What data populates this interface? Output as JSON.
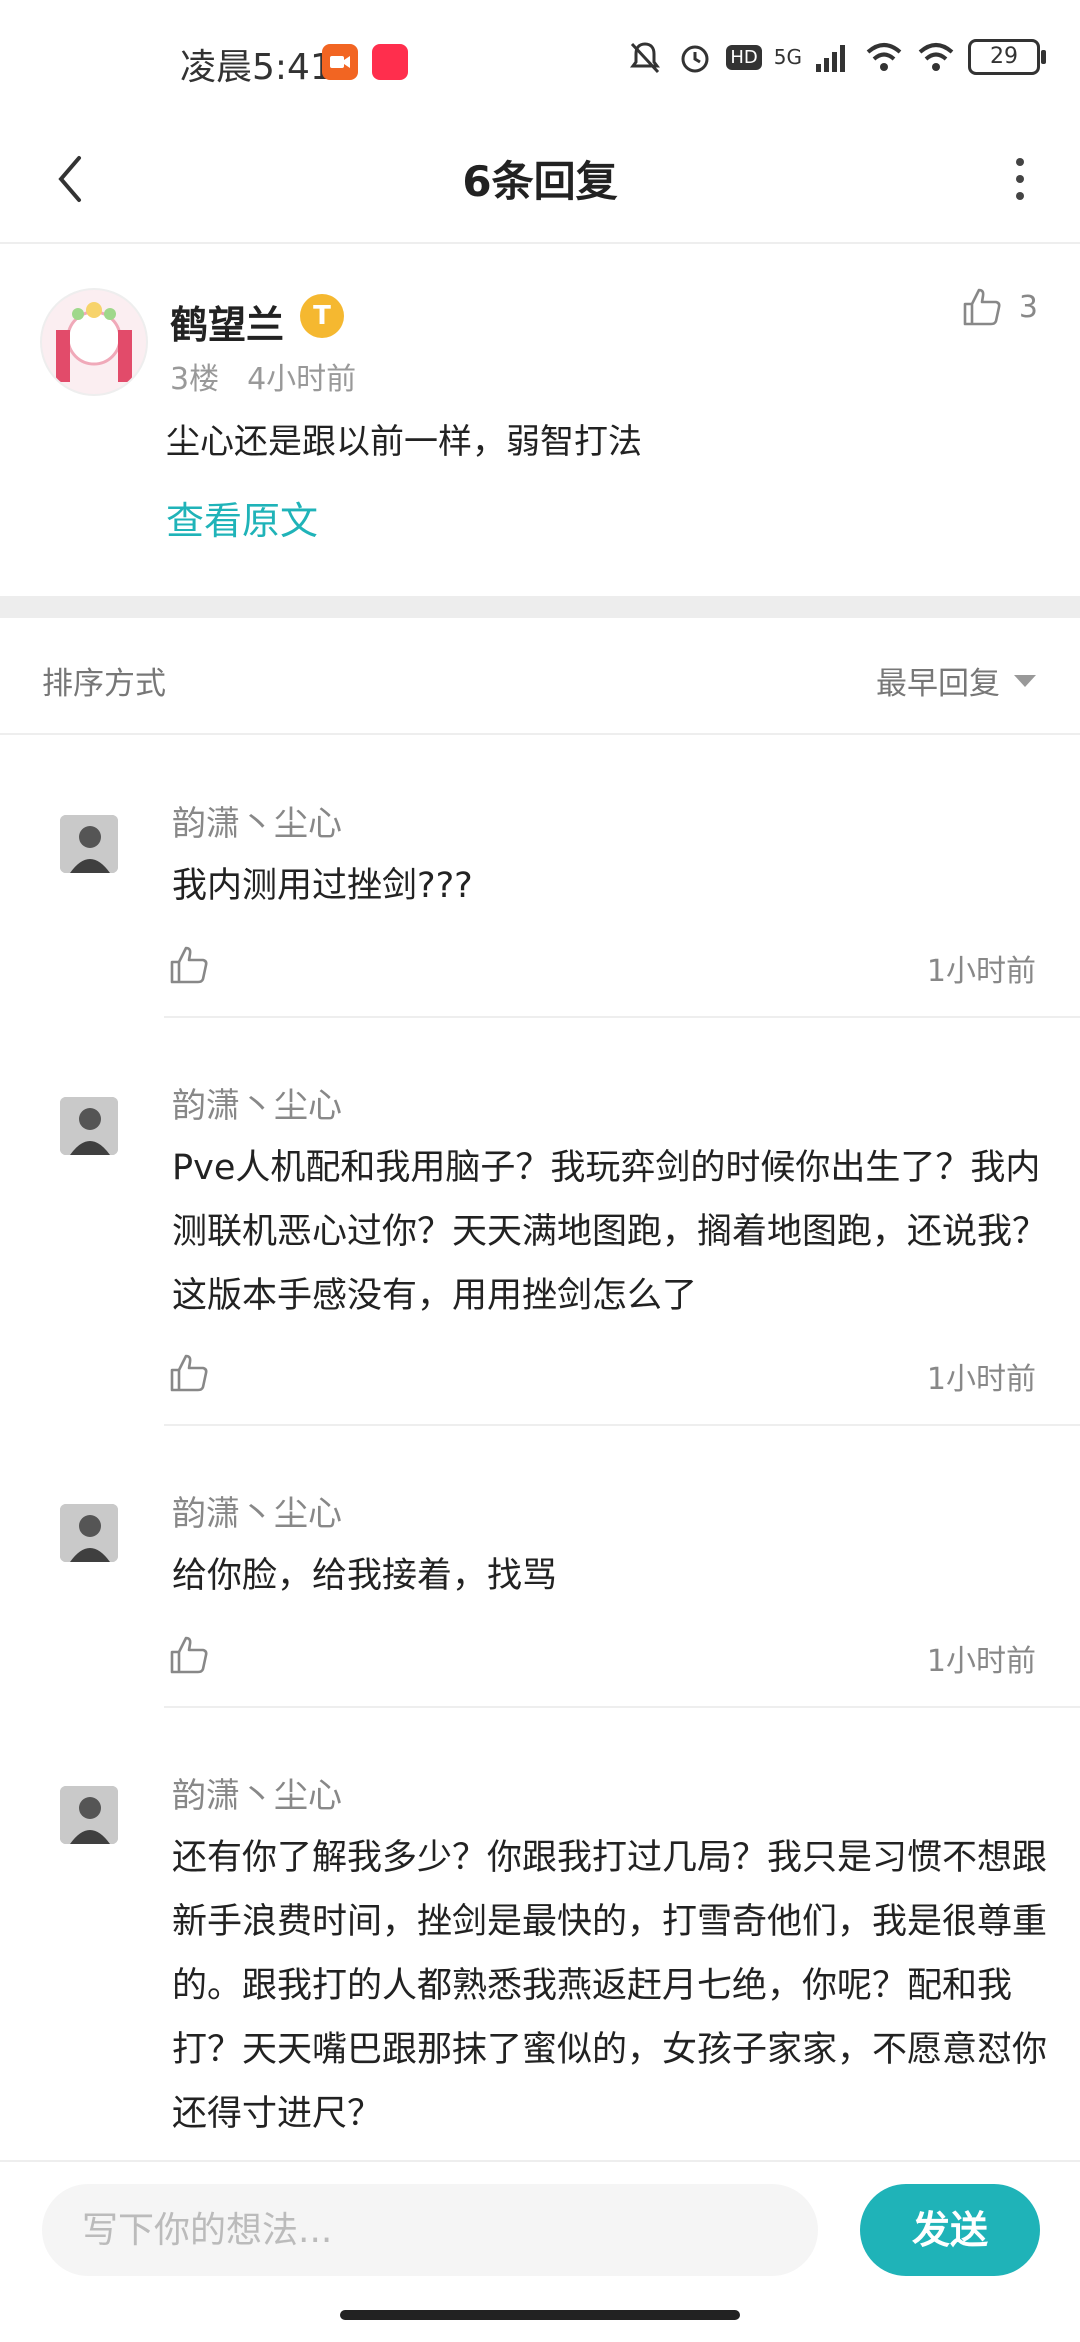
{
  "status_bar": {
    "time": "凌晨5:41",
    "network": "5G",
    "battery": "29",
    "hd": "HD"
  },
  "header": {
    "title": "6条回复"
  },
  "post": {
    "author": "鹤望兰",
    "badge": "T",
    "floor": "3楼",
    "time": "4小时前",
    "likes": "3",
    "text": "尘心还是跟以前一样，弱智打法",
    "view_original": "查看原文"
  },
  "sort": {
    "label": "排序方式",
    "value": "最早回复"
  },
  "replies": [
    {
      "author": "韵潇丶尘心",
      "text": "我内测用过挫剑???",
      "time": "1小时前"
    },
    {
      "author": "韵潇丶尘心",
      "text": "Pve人机配和我用脑子？我玩弈剑的时候你出生了？我内测联机恶心过你？天天满地图跑，搁着地图跑，还说我？这版本手感没有，用用挫剑怎么了",
      "time": "1小时前"
    },
    {
      "author": "韵潇丶尘心",
      "text": "给你脸，给我接着，找骂",
      "time": "1小时前"
    },
    {
      "author": "韵潇丶尘心",
      "text": "还有你了解我多少？你跟我打过几局？我只是习惯不想跟新手浪费时间，挫剑是最快的，打雪奇他们，我是很尊重的。跟我打的人都熟悉我燕返赶月七绝，你呢？配和我打？天天嘴巴跟那抹了蜜似的，女孩子家家，不愿意怼你还得寸进尺？",
      "time": ""
    }
  ],
  "composer": {
    "placeholder": "写下你的想法...",
    "send_label": "发送"
  },
  "colors": {
    "accent": "#1fb3b8",
    "badge": "#f5b830"
  }
}
